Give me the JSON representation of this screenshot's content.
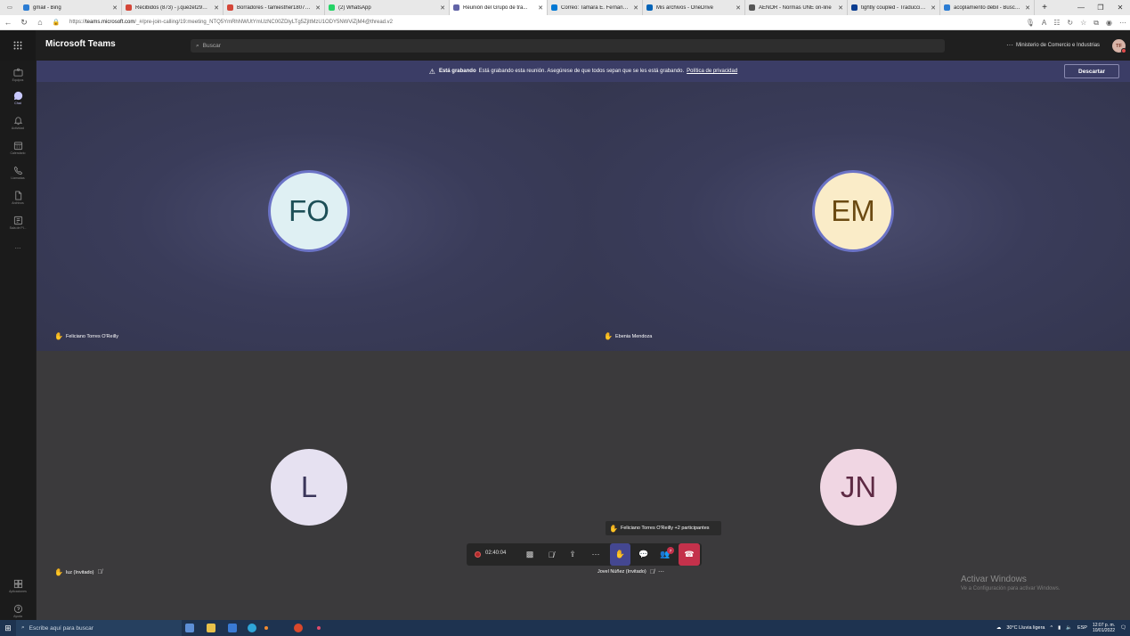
{
  "browser": {
    "tabs": [
      {
        "label": "gmail - Bing",
        "color": "#2b7cd3"
      },
      {
        "label": "Recibidos (873) - j.quezet290@...",
        "color": "#d44638"
      },
      {
        "label": "Borradores - tamiesther18077...",
        "color": "#d44638"
      },
      {
        "label": "(2) WhatsApp",
        "color": "#25d366"
      },
      {
        "label": "Reunión del Grupo de tra...",
        "color": "#6264a7"
      },
      {
        "label": "Correo: Tamara E. Fernandez R...",
        "color": "#0078d4"
      },
      {
        "label": "Mis archivos - OneDrive",
        "color": "#0364b8"
      },
      {
        "label": "AENOR - Normas UNE on-line",
        "color": "#555555"
      },
      {
        "label": "tightly coupled - Traducción al...",
        "color": "#0b3d91"
      },
      {
        "label": "acoplamiento debil - Buscar c...",
        "color": "#2b7cd3"
      }
    ],
    "new_tab": "+",
    "url_prefix": "https://",
    "url_host": "teams.microsoft.com",
    "url_rest": "/_#/pre-join-calling/19:meeting_NTQ5YmRhNWUtYmUzNC00ZDlyLTg5ZjItMzU1ODY5NWViZjM4@thread.v2"
  },
  "teams": {
    "app_title": "Microsoft Teams",
    "search_placeholder": "Buscar",
    "org_name": "Ministerio de Comercio e Industrias",
    "avatar_initials": "TF",
    "more": "···"
  },
  "rail": [
    {
      "label": "Equipos",
      "icon": "teams-icon"
    },
    {
      "label": "Chat",
      "icon": "chat-icon"
    },
    {
      "label": "Actividad",
      "icon": "bell-icon"
    },
    {
      "label": "Calendario",
      "icon": "calendar-icon"
    },
    {
      "label": "Llamadas",
      "icon": "phone-icon"
    },
    {
      "label": "Archivos",
      "icon": "file-icon"
    },
    {
      "label": "Sala de Pl...",
      "icon": "whiteboard-icon"
    },
    {
      "label": "...",
      "icon": "more-icon"
    }
  ],
  "rail_bottom": [
    {
      "label": "Aplicaciones",
      "icon": "apps-icon"
    },
    {
      "label": "Ayuda",
      "icon": "help-icon"
    }
  ],
  "banner": {
    "bold": "Está grabando",
    "text": "Está grabando esta reunión. Asegúrese de que todos sepan que se les está grabando.",
    "link": "Política de privacidad",
    "dismiss": "Descartar"
  },
  "participants": [
    {
      "initials": "FO",
      "name": "Feliciano Torres O'Reilly",
      "hand_raised": true,
      "muted": false,
      "bg": "#dff0f3",
      "fg": "#1d4f57"
    },
    {
      "initials": "EM",
      "name": "Ebenia Mendoza",
      "hand_raised": true,
      "muted": false,
      "bg": "#faecc8",
      "fg": "#6b4a12"
    },
    {
      "initials": "L",
      "name": "luz (Invitado)",
      "hand_raised": true,
      "muted": true,
      "bg": "#e6e1f1",
      "fg": "#3a355a"
    },
    {
      "initials": "JN",
      "name": "Jovel Núñez (Invitado)",
      "hand_raised": false,
      "muted": true,
      "bg": "#f0d6e3",
      "fg": "#5e2a44"
    }
  ],
  "controls": {
    "timer": "02:40:04",
    "participants_badge": "7"
  },
  "tooltip": "Feliciano Torres O'Reilly +2 participantes",
  "watermark": {
    "title": "Activar Windows",
    "subtitle": "Ve a Configuración para activar Windows."
  },
  "taskbar": {
    "search": "Escribe aquí para buscar",
    "weather": "30°C  Lluvia ligera",
    "lang": "ESP",
    "time": "12:07 p. m.",
    "date": "10/01/2022"
  }
}
